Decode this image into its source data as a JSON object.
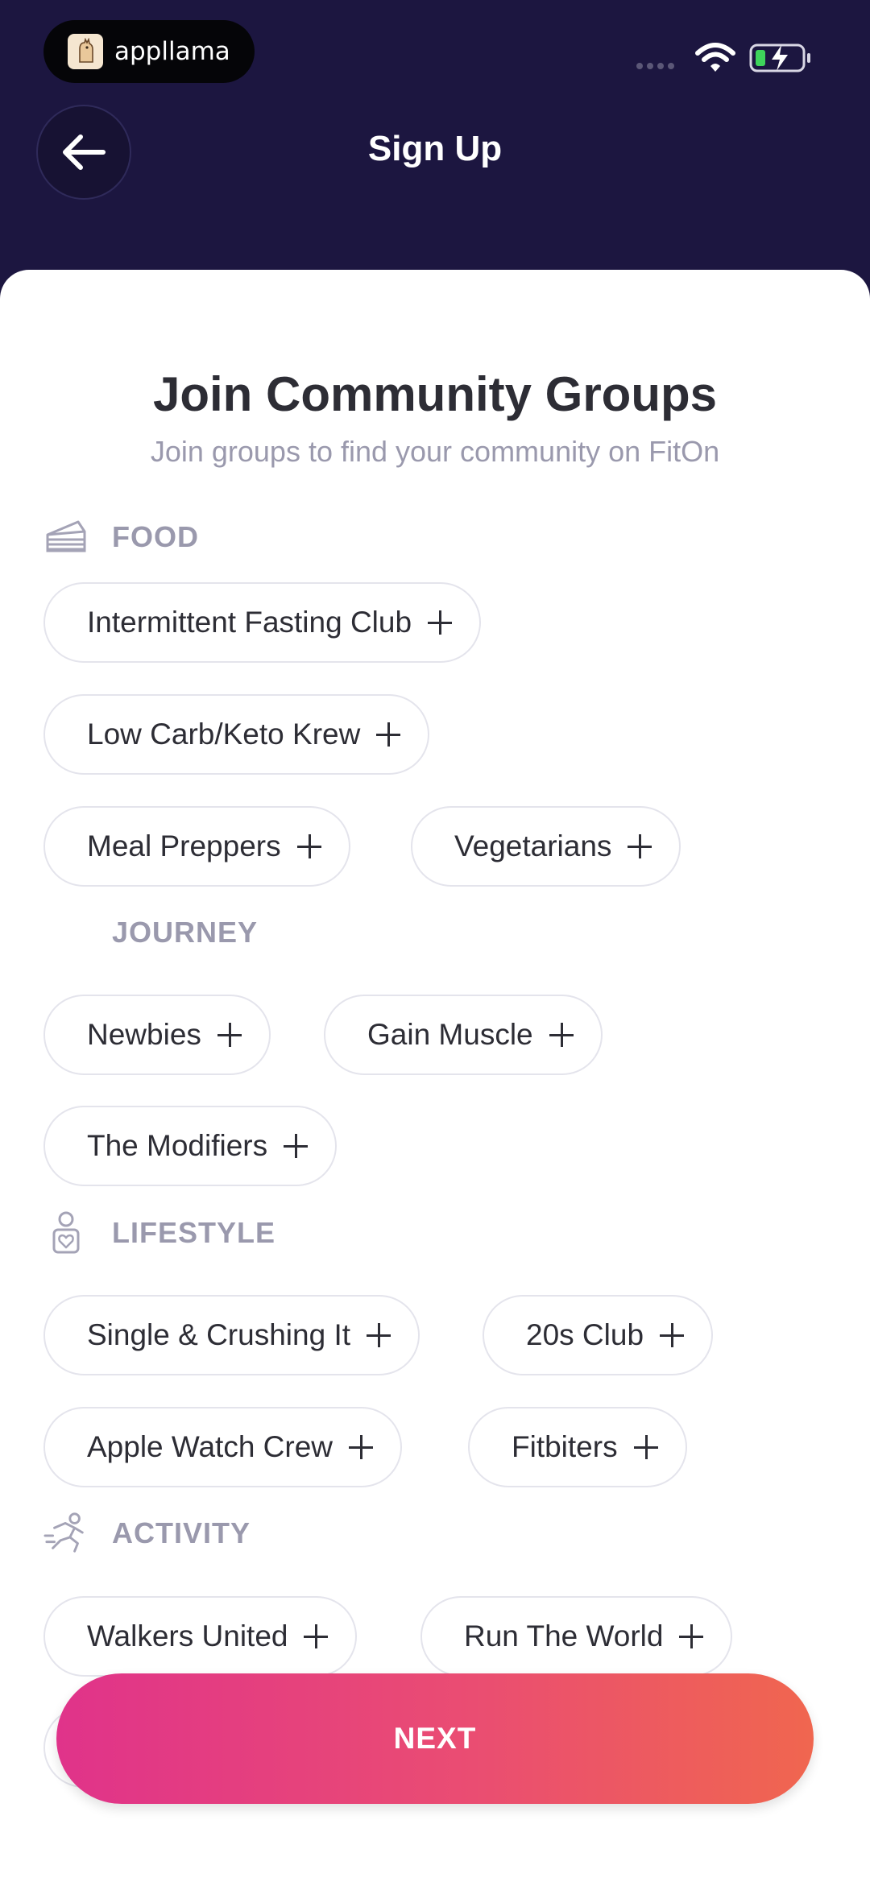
{
  "status_bar": {
    "brand": "appllama"
  },
  "header": {
    "title": "Sign Up"
  },
  "content": {
    "heading": "Join Community Groups",
    "subheading": "Join groups to find your community on FitOn"
  },
  "sections": {
    "food": {
      "label": "FOOD",
      "chips": [
        "Intermittent Fasting Club",
        "Low Carb/Keto Krew",
        "Meal Preppers",
        "Vegetarians"
      ]
    },
    "journey": {
      "label": "JOURNEY",
      "chips": [
        "Newbies",
        "Gain Muscle",
        "The Modifiers"
      ]
    },
    "lifestyle": {
      "label": "LIFESTYLE",
      "chips": [
        "Single & Crushing It",
        "20s Club",
        "Apple Watch Crew",
        "Fitbiters"
      ]
    },
    "activity": {
      "label": "ACTIVITY",
      "chips": [
        "Walkers United",
        "Run The World"
      ]
    }
  },
  "footer": {
    "next_label": "NEXT"
  },
  "colors": {
    "header_bg": "#1c1640",
    "accent_gradient_start": "#e0338a",
    "accent_gradient_end": "#f0664f",
    "section_label": "#9a99ad"
  }
}
